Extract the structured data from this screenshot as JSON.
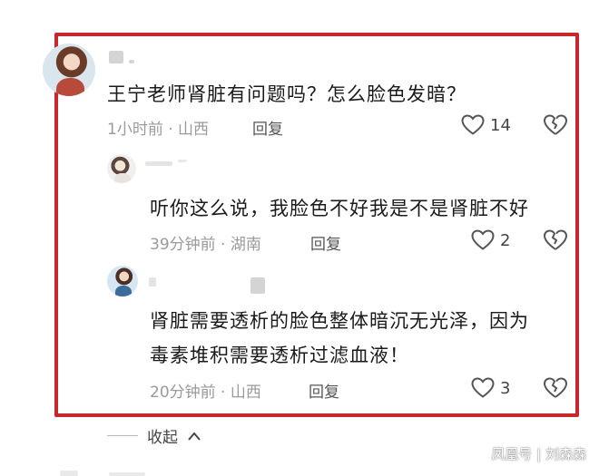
{
  "comments": [
    {
      "text": "王宁老师肾脏有问题吗？怎么脸色发暗？",
      "meta": "1小时前 · 山西",
      "reply": "回复",
      "likes": "14",
      "like_icon": "heart-outline-icon",
      "dislike_icon": "broken-heart-icon"
    },
    {
      "text": "听你这么说，我脸色不好我是不是肾脏不好",
      "meta": "39分钟前 · 湖南",
      "reply": "回复",
      "likes": "2"
    },
    {
      "text_line1": "肾脏需要透析的脸色整体暗沉无光泽，因为",
      "text_line2": "毒素堆积需要透析过滤血液！",
      "meta": "20分钟前 · 山西",
      "reply": "回复",
      "likes": "3"
    }
  ],
  "collapse": {
    "label": "收起",
    "icon": "chevron-up-icon"
  },
  "watermark": "凤凰号 | 刘森森",
  "colors": {
    "frame": "#c8282c",
    "meta": "#9a9a9a",
    "icon": "#555555"
  }
}
